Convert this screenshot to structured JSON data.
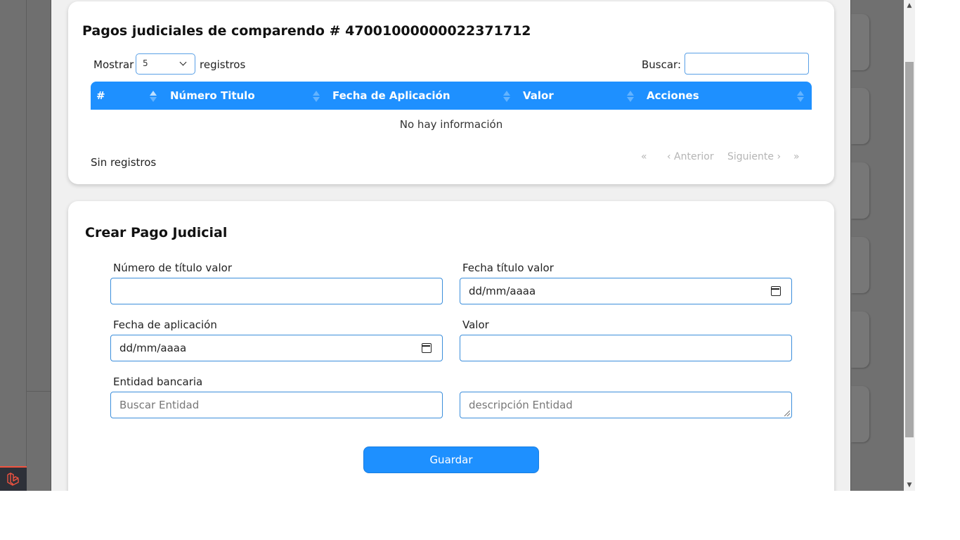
{
  "pagos_card": {
    "title": "Pagos judiciales de comparendo # 47001000000022371712",
    "show_label": "Mostrar",
    "page_size": "5",
    "records_label": "registros",
    "search_label": "Buscar:",
    "search_value": "",
    "columns": [
      "#",
      "Número Titulo",
      "Fecha de Aplicación",
      "Valor",
      "Acciones"
    ],
    "empty_message": "No hay información",
    "info_text": "Sin registros",
    "pagination": {
      "first": "«",
      "prev": "‹ Anterior",
      "next": "Siguiente ›",
      "last": "»"
    }
  },
  "form_card": {
    "title": "Crear Pago Judicial",
    "fields": {
      "numero_titulo": {
        "label": "Número de título valor",
        "value": ""
      },
      "fecha_titulo": {
        "label": "Fecha título valor",
        "value": "dd/mm/aaaa"
      },
      "fecha_aplicacion": {
        "label": "Fecha de aplicación",
        "value": "dd/mm/aaaa"
      },
      "valor": {
        "label": "Valor",
        "value": ""
      },
      "entidad": {
        "label": "Entidad bancaria",
        "placeholder": "Buscar Entidad"
      },
      "descripcion": {
        "placeholder": "descripción Entidad"
      }
    },
    "save_label": "Guardar"
  },
  "colors": {
    "accent": "#1e90ff",
    "header_sort_icon": "#63b3ff",
    "overlay": "#6f6f6f",
    "pager_disabled": "#b5b5b5"
  },
  "icons": {
    "select_caret": "chevron-down-icon",
    "date_picker": "calendar-icon",
    "sort": "sort-icon",
    "badge": "laravel-icon"
  }
}
